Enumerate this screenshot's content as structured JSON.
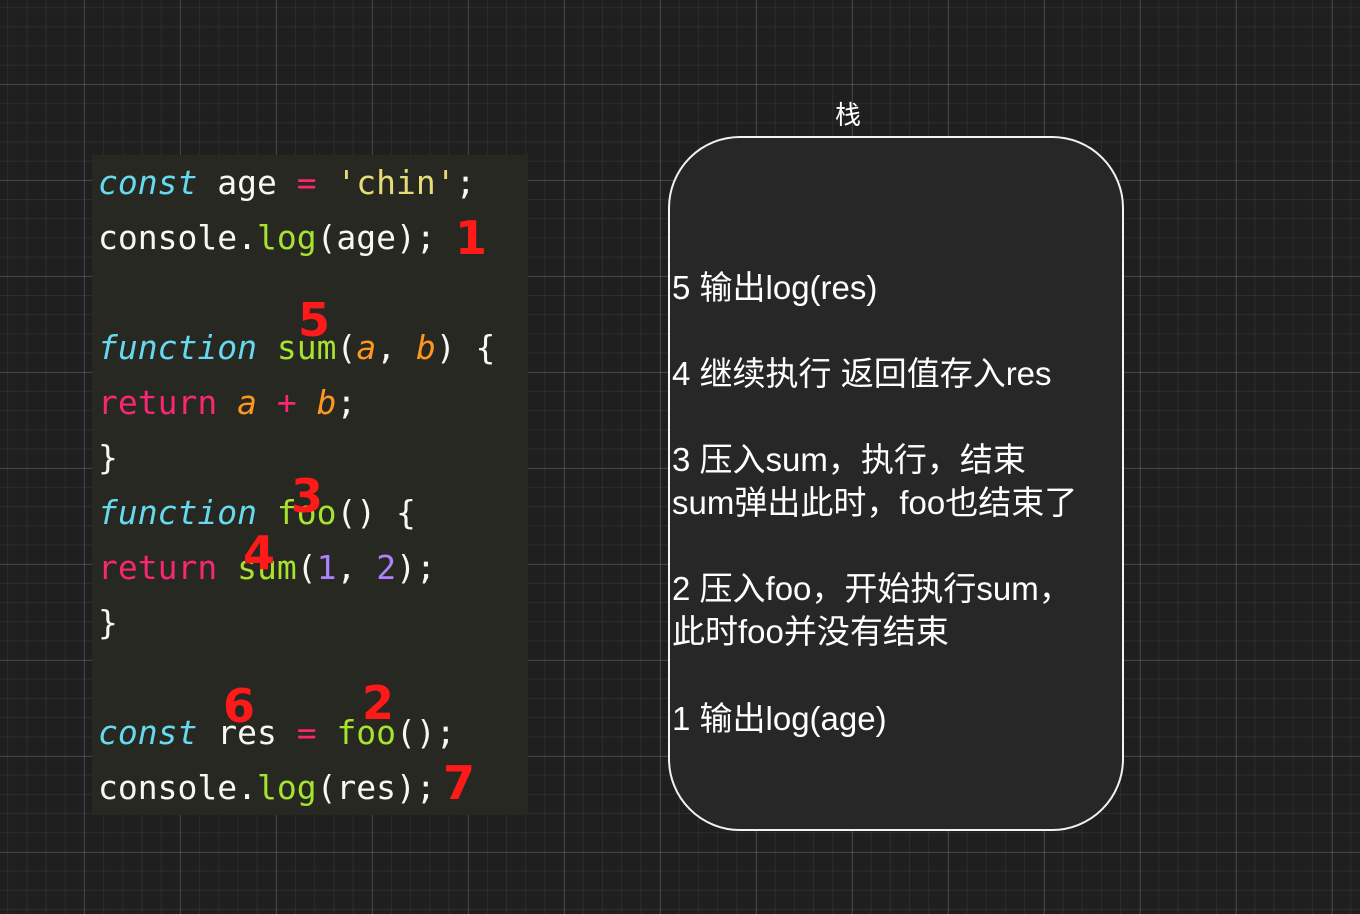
{
  "code": {
    "line1": {
      "kw": "const",
      "name": " age ",
      "op": "=",
      "sp": " ",
      "str": "'chin'",
      "end": ";"
    },
    "line2": {
      "obj": "console.",
      "fn": "log",
      "args": "(age);"
    },
    "line4": {
      "kw": "function",
      "sp": " ",
      "fn": "sum",
      "open": "(",
      "p1": "a",
      "comma": ", ",
      "p2": "b",
      "close": ") {"
    },
    "line5": {
      "kw": "return",
      "sp1": " ",
      "p1": "a",
      "sp2": " ",
      "op": "+",
      "sp3": " ",
      "p2": "b",
      "end": ";"
    },
    "line6": {
      "text": "}"
    },
    "line7": {
      "kw": "function",
      "sp": " ",
      "fn": "foo",
      "rest": "() {"
    },
    "line8": {
      "kw": "return",
      "sp": " ",
      "fn": "sum",
      "open": "(",
      "n1": "1",
      "comma": ", ",
      "n2": "2",
      "end": ");"
    },
    "line9": {
      "text": "}"
    },
    "line11": {
      "kw": "const",
      "name": " res ",
      "op": "=",
      "sp": " ",
      "fn": "foo",
      "end": "();"
    },
    "line12": {
      "obj": "console.",
      "fn": "log",
      "args": "(res);"
    }
  },
  "markers": [
    "1",
    "5",
    "3",
    "4",
    "6",
    "2",
    "7"
  ],
  "stack": {
    "title": "栈",
    "items": [
      {
        "lines": [
          "5 输出log(res)"
        ]
      },
      {
        "lines": [
          "4 继续执行 返回值存入res"
        ]
      },
      {
        "lines": [
          "3 压入sum，执行，结束",
          "sum弹出此时，foo也结束了"
        ]
      },
      {
        "lines": [
          "2 压入foo，开始执行sum，",
          "此时foo并没有结束"
        ]
      },
      {
        "lines": [
          "1 输出log(age)"
        ]
      }
    ]
  },
  "colors": {
    "background": "#1f1f1f",
    "code_background": "#272822",
    "keyword_italic": "#66d9ef",
    "keyword_return": "#f92672",
    "string": "#e6db74",
    "function": "#a6e22e",
    "parameter": "#fd971f",
    "number": "#ae81ff",
    "marker": "#ff1a1a",
    "stack_border": "#f2f2f2"
  }
}
